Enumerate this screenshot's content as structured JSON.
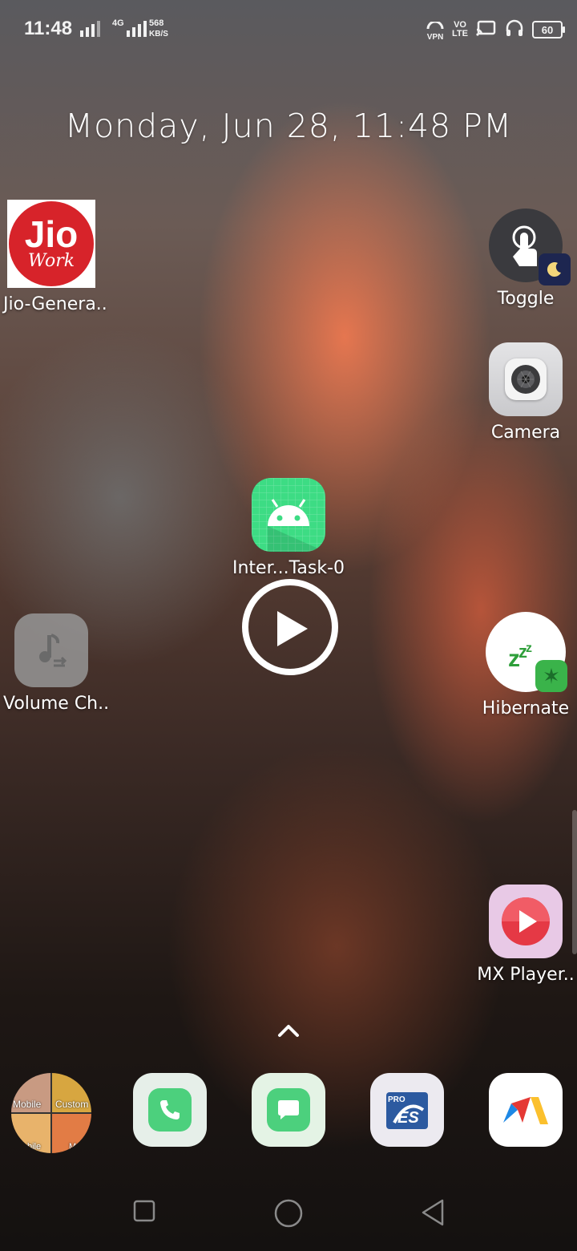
{
  "status_bar": {
    "time": "11:48",
    "network_type": "4G",
    "speed_value": "568",
    "speed_unit": "KB/S",
    "vpn_label": "VPN",
    "volte_top": "VO",
    "volte_bottom": "LTE",
    "battery": "60"
  },
  "date_time": "Monday, Jun 28, 11:48 PM",
  "apps": {
    "jio": {
      "label": "Jio-Genera..",
      "logo_text": "Jio",
      "logo_sub": "Work"
    },
    "toggle": {
      "label": "Toggle"
    },
    "camera": {
      "label": "Camera"
    },
    "inter_task": {
      "label": "Inter...Task-0"
    },
    "volume": {
      "label": "Volume Ch.."
    },
    "hibernate": {
      "label": "Hibernate"
    },
    "mx_player": {
      "label": "MX Player.."
    }
  },
  "dock": {
    "folder_labels": [
      "Mobile",
      "Custom",
      "bile",
      "M"
    ],
    "items": [
      "phone",
      "messages",
      "es-file-explorer-pro",
      "app-drawer-launcher"
    ],
    "es_label": "PRO"
  },
  "colors": {
    "jio_red": "#d7232a",
    "android_green": "#3ddc84",
    "dock_green": "#4cd07d",
    "mx_pink": "#e8c9e6",
    "mx_red": "#e53945"
  }
}
